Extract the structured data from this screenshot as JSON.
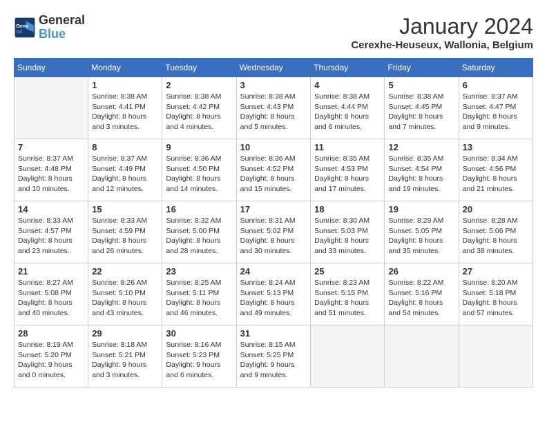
{
  "header": {
    "logo_text_top": "General",
    "logo_text_bottom": "Blue",
    "title": "January 2024",
    "subtitle": "Cerexhe-Heuseux, Wallonia, Belgium"
  },
  "days_of_week": [
    "Sunday",
    "Monday",
    "Tuesday",
    "Wednesday",
    "Thursday",
    "Friday",
    "Saturday"
  ],
  "weeks": [
    [
      {
        "day": "",
        "empty": true
      },
      {
        "day": "1",
        "sunrise": "8:38 AM",
        "sunset": "4:41 PM",
        "daylight": "8 hours and 3 minutes."
      },
      {
        "day": "2",
        "sunrise": "8:38 AM",
        "sunset": "4:42 PM",
        "daylight": "8 hours and 4 minutes."
      },
      {
        "day": "3",
        "sunrise": "8:38 AM",
        "sunset": "4:43 PM",
        "daylight": "8 hours and 5 minutes."
      },
      {
        "day": "4",
        "sunrise": "8:38 AM",
        "sunset": "4:44 PM",
        "daylight": "8 hours and 6 minutes."
      },
      {
        "day": "5",
        "sunrise": "8:38 AM",
        "sunset": "4:45 PM",
        "daylight": "8 hours and 7 minutes."
      },
      {
        "day": "6",
        "sunrise": "8:37 AM",
        "sunset": "4:47 PM",
        "daylight": "8 hours and 9 minutes."
      }
    ],
    [
      {
        "day": "7",
        "sunrise": "8:37 AM",
        "sunset": "4:48 PM",
        "daylight": "8 hours and 10 minutes."
      },
      {
        "day": "8",
        "sunrise": "8:37 AM",
        "sunset": "4:49 PM",
        "daylight": "8 hours and 12 minutes."
      },
      {
        "day": "9",
        "sunrise": "8:36 AM",
        "sunset": "4:50 PM",
        "daylight": "8 hours and 14 minutes."
      },
      {
        "day": "10",
        "sunrise": "8:36 AM",
        "sunset": "4:52 PM",
        "daylight": "8 hours and 15 minutes."
      },
      {
        "day": "11",
        "sunrise": "8:35 AM",
        "sunset": "4:53 PM",
        "daylight": "8 hours and 17 minutes."
      },
      {
        "day": "12",
        "sunrise": "8:35 AM",
        "sunset": "4:54 PM",
        "daylight": "8 hours and 19 minutes."
      },
      {
        "day": "13",
        "sunrise": "8:34 AM",
        "sunset": "4:56 PM",
        "daylight": "8 hours and 21 minutes."
      }
    ],
    [
      {
        "day": "14",
        "sunrise": "8:33 AM",
        "sunset": "4:57 PM",
        "daylight": "8 hours and 23 minutes."
      },
      {
        "day": "15",
        "sunrise": "8:33 AM",
        "sunset": "4:59 PM",
        "daylight": "8 hours and 26 minutes."
      },
      {
        "day": "16",
        "sunrise": "8:32 AM",
        "sunset": "5:00 PM",
        "daylight": "8 hours and 28 minutes."
      },
      {
        "day": "17",
        "sunrise": "8:31 AM",
        "sunset": "5:02 PM",
        "daylight": "8 hours and 30 minutes."
      },
      {
        "day": "18",
        "sunrise": "8:30 AM",
        "sunset": "5:03 PM",
        "daylight": "8 hours and 33 minutes."
      },
      {
        "day": "19",
        "sunrise": "8:29 AM",
        "sunset": "5:05 PM",
        "daylight": "8 hours and 35 minutes."
      },
      {
        "day": "20",
        "sunrise": "8:28 AM",
        "sunset": "5:06 PM",
        "daylight": "8 hours and 38 minutes."
      }
    ],
    [
      {
        "day": "21",
        "sunrise": "8:27 AM",
        "sunset": "5:08 PM",
        "daylight": "8 hours and 40 minutes."
      },
      {
        "day": "22",
        "sunrise": "8:26 AM",
        "sunset": "5:10 PM",
        "daylight": "8 hours and 43 minutes."
      },
      {
        "day": "23",
        "sunrise": "8:25 AM",
        "sunset": "5:11 PM",
        "daylight": "8 hours and 46 minutes."
      },
      {
        "day": "24",
        "sunrise": "8:24 AM",
        "sunset": "5:13 PM",
        "daylight": "8 hours and 49 minutes."
      },
      {
        "day": "25",
        "sunrise": "8:23 AM",
        "sunset": "5:15 PM",
        "daylight": "8 hours and 51 minutes."
      },
      {
        "day": "26",
        "sunrise": "8:22 AM",
        "sunset": "5:16 PM",
        "daylight": "8 hours and 54 minutes."
      },
      {
        "day": "27",
        "sunrise": "8:20 AM",
        "sunset": "5:18 PM",
        "daylight": "8 hours and 57 minutes."
      }
    ],
    [
      {
        "day": "28",
        "sunrise": "8:19 AM",
        "sunset": "5:20 PM",
        "daylight": "9 hours and 0 minutes."
      },
      {
        "day": "29",
        "sunrise": "8:18 AM",
        "sunset": "5:21 PM",
        "daylight": "9 hours and 3 minutes."
      },
      {
        "day": "30",
        "sunrise": "8:16 AM",
        "sunset": "5:23 PM",
        "daylight": "9 hours and 6 minutes."
      },
      {
        "day": "31",
        "sunrise": "8:15 AM",
        "sunset": "5:25 PM",
        "daylight": "9 hours and 9 minutes."
      },
      {
        "day": "",
        "empty": true
      },
      {
        "day": "",
        "empty": true
      },
      {
        "day": "",
        "empty": true
      }
    ]
  ]
}
